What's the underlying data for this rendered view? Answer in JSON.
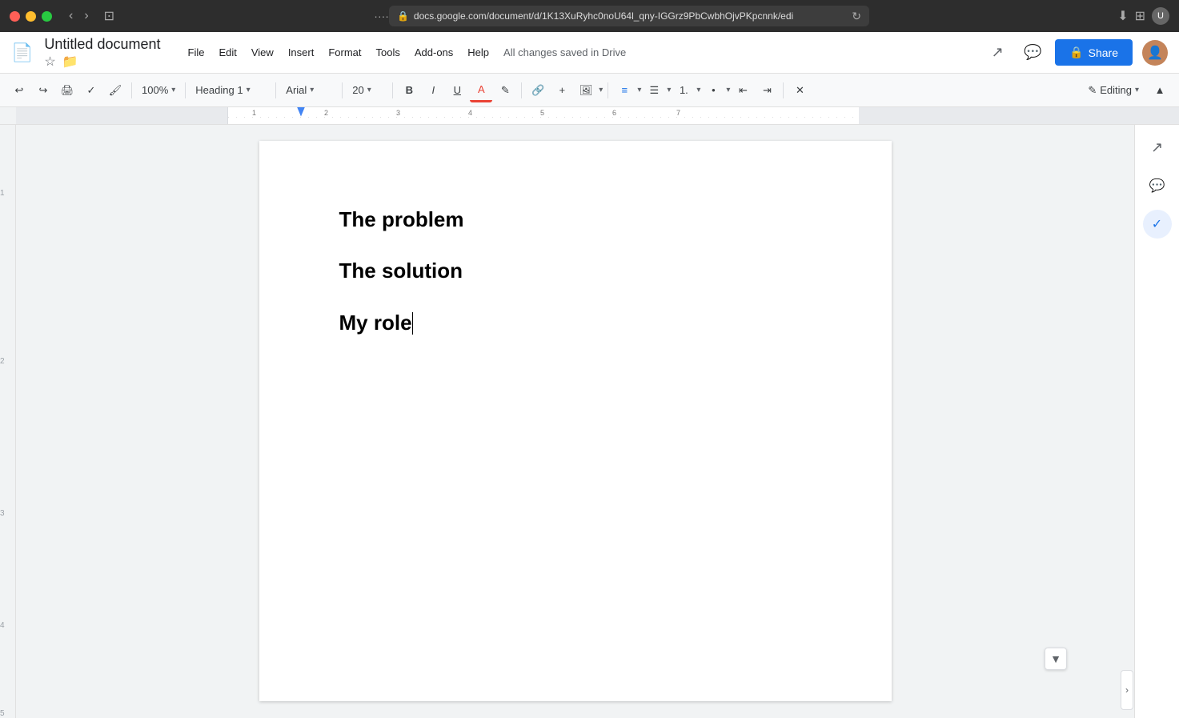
{
  "titlebar": {
    "address": "docs.google.com/document/d/1K13XuRyhc0noU64l_qny-IGGrz9PbCwbhOjvPKpcnnk/edi",
    "nav_back": "‹",
    "nav_forward": "›"
  },
  "appbar": {
    "doc_icon": "📄",
    "doc_title": "Untitled document",
    "menu_items": [
      "File",
      "Edit",
      "View",
      "Insert",
      "Format",
      "Tools",
      "Add-ons",
      "Help"
    ],
    "saved_text": "All changes saved in Drive",
    "share_label": "Share",
    "editing_label": "Editing"
  },
  "toolbar": {
    "undo": "↩",
    "redo": "↪",
    "print": "🖨",
    "paint_format": "🎨",
    "zoom": "100%",
    "heading": "Heading 1",
    "font": "Arial",
    "font_size": "20",
    "bold": "B",
    "italic": "I",
    "underline": "U",
    "text_color": "A",
    "highlight": "✎",
    "link": "🔗",
    "insert_special": "+",
    "insert_image": "🖼",
    "align_left": "≡",
    "align_center": "≡",
    "align_right": "≡",
    "align_justify": "≡",
    "numbered_list": "1.",
    "bulleted_list": "•",
    "indent_decrease": "←",
    "indent_increase": "→",
    "clear_format": "✕"
  },
  "document": {
    "lines": [
      {
        "text": "The problem",
        "has_cursor": false
      },
      {
        "text": "The solution",
        "has_cursor": false
      },
      {
        "text": "My role",
        "has_cursor": true
      }
    ]
  },
  "sidebar": {
    "icons": [
      {
        "name": "trending-up-icon",
        "glyph": "↗",
        "active": false
      },
      {
        "name": "chat-icon",
        "glyph": "💬",
        "active": false
      },
      {
        "name": "check-icon",
        "glyph": "✓",
        "active": true
      }
    ]
  },
  "colors": {
    "accent_blue": "#1a73e8",
    "text_dark": "#202124",
    "text_gray": "#5f6368"
  }
}
